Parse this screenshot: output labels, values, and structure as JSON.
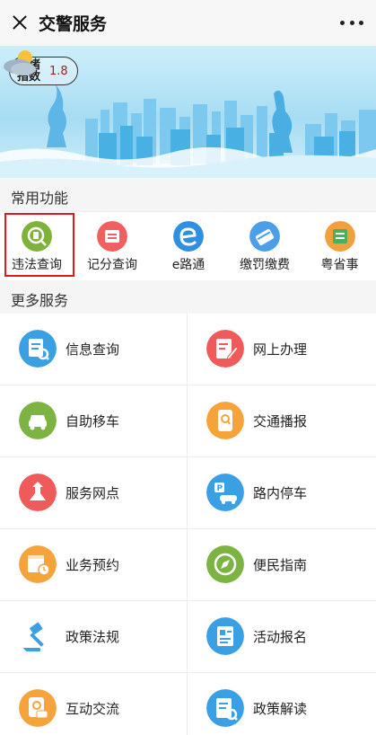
{
  "header": {
    "title": "交警服务"
  },
  "banner": {
    "jam_label": "拥堵指数",
    "jam_value": "1.8",
    "sky_color": "#a7dcf3",
    "city_color": "#49b0e3"
  },
  "common": {
    "heading": "常用功能",
    "items": [
      {
        "label": "违法查询",
        "icon": "traffic-violation-icon",
        "color": "#7fb23a"
      },
      {
        "label": "记分查询",
        "icon": "driving-points-icon",
        "color": "#f06060"
      },
      {
        "label": "e路通",
        "icon": "e-road-icon",
        "color": "#2f8fe0"
      },
      {
        "label": "缴罚缴费",
        "icon": "fine-payment-icon",
        "color": "#4a9fe8"
      },
      {
        "label": "粤省事",
        "icon": "yue-sheng-shi-icon",
        "color": "#f2a03d"
      }
    ]
  },
  "more": {
    "heading": "更多服务",
    "items": [
      {
        "label": "信息查询",
        "icon": "info-query-icon",
        "color": "#3a9fe3"
      },
      {
        "label": "网上办理",
        "icon": "online-handling-icon",
        "color": "#ef5a5a"
      },
      {
        "label": "自助移车",
        "icon": "self-move-car-icon",
        "color": "#7cb342"
      },
      {
        "label": "交通播报",
        "icon": "traffic-broadcast-icon",
        "color": "#f5a33b"
      },
      {
        "label": "服务网点",
        "icon": "service-outlet-icon",
        "color": "#ef5a5a"
      },
      {
        "label": "路内停车",
        "icon": "street-parking-icon",
        "color": "#3a9fe3"
      },
      {
        "label": "业务预约",
        "icon": "appointment-icon",
        "color": "#f5a33b"
      },
      {
        "label": "便民指南",
        "icon": "compass-icon",
        "color": "#7cb342"
      },
      {
        "label": "政策法规",
        "icon": "gavel-icon",
        "color": "#3a9fe3"
      },
      {
        "label": "活动报名",
        "icon": "event-signup-icon",
        "color": "#3a9fe3"
      },
      {
        "label": "互动交流",
        "icon": "interaction-icon",
        "color": "#f5a33b"
      },
      {
        "label": "政策解读",
        "icon": "policy-reading-icon",
        "color": "#3a9fe3"
      }
    ]
  }
}
